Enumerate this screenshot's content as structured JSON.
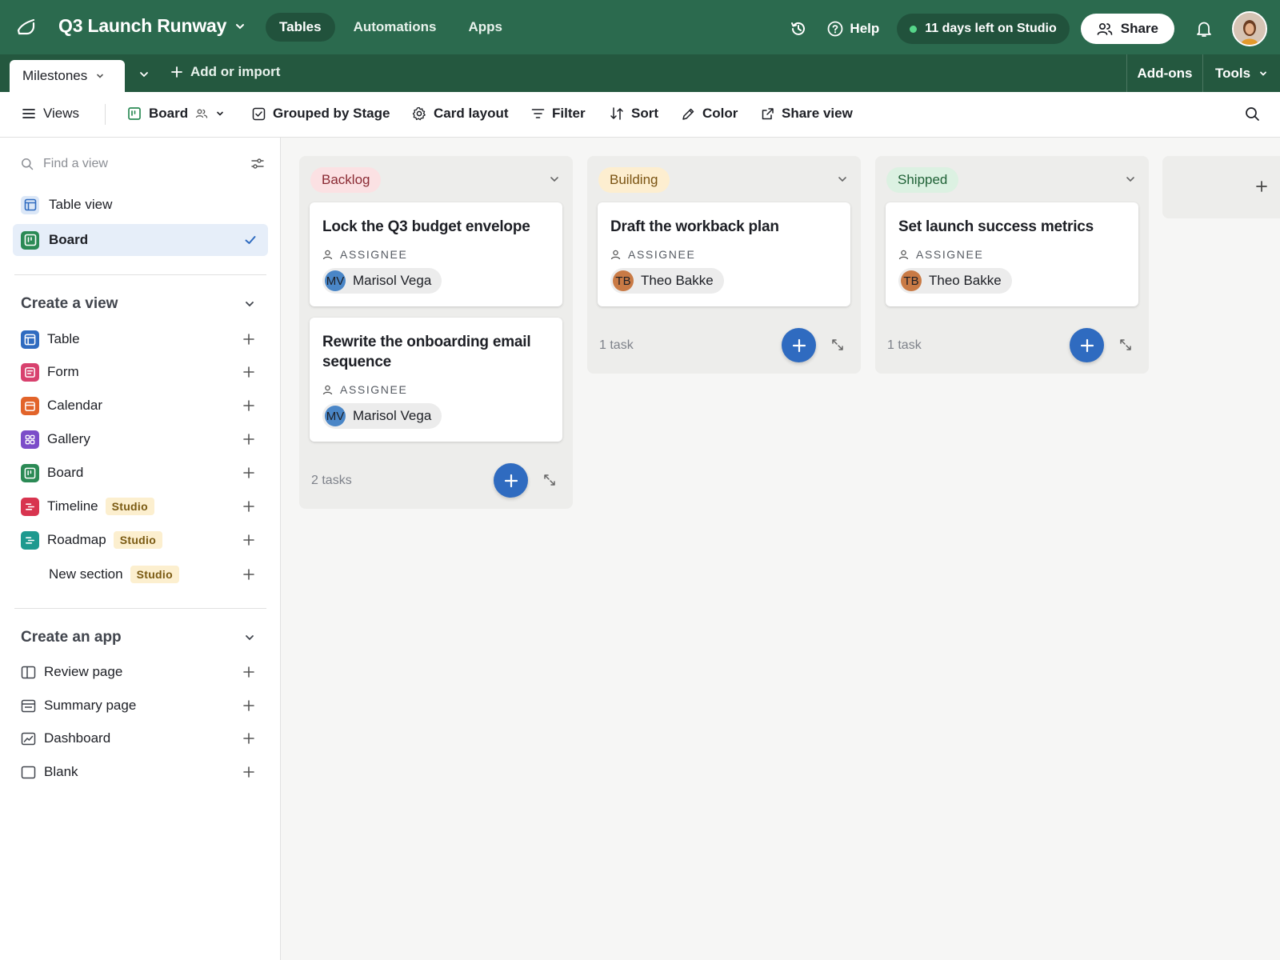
{
  "header": {
    "base_title": "Q3 Launch Runway",
    "nav": [
      "Tables",
      "Automations",
      "Apps"
    ],
    "active_nav": "Tables",
    "help": "Help",
    "trial": "11 days left on Studio",
    "share": "Share",
    "icons": [
      "base-logo-icon",
      "history-icon",
      "help-icon",
      "share-people-icon",
      "bell-icon",
      "user-avatar"
    ]
  },
  "tablebar": {
    "active_table": "Milestones",
    "add_or_import": "Add or import",
    "addons": "Add-ons",
    "tools": "Tools"
  },
  "viewbar": {
    "views": "Views",
    "view_name": "Board",
    "grouped": "Grouped by Stage",
    "card_layout": "Card layout",
    "filter": "Filter",
    "sort": "Sort",
    "color": "Color",
    "share_view": "Share view"
  },
  "sidebar": {
    "find_placeholder": "Find a view",
    "views": [
      {
        "label": "Table view",
        "selected": false
      },
      {
        "label": "Board",
        "selected": true
      }
    ],
    "create_view_title": "Create a view",
    "create_view_items": [
      {
        "label": "Table",
        "badge": ""
      },
      {
        "label": "Form",
        "badge": ""
      },
      {
        "label": "Calendar",
        "badge": ""
      },
      {
        "label": "Gallery",
        "badge": ""
      },
      {
        "label": "Board",
        "badge": ""
      },
      {
        "label": "Timeline",
        "badge": "Studio"
      },
      {
        "label": "Roadmap",
        "badge": "Studio"
      },
      {
        "label": "New section",
        "badge": "Studio"
      }
    ],
    "create_app_title": "Create an app",
    "create_app_items": [
      "Review page",
      "Summary page",
      "Dashboard",
      "Blank"
    ]
  },
  "board": {
    "field_label": "ASSIGNEE",
    "stacks": [
      {
        "stage": "Backlog",
        "pill_bg": "#fbe1e3",
        "pill_fg": "#8a2a33",
        "count": "2 tasks",
        "cards": [
          {
            "title": "Lock the Q3 budget envelope",
            "assignee": "Marisol Vega",
            "initials": "MV",
            "avatar_color": "#4a86c7"
          },
          {
            "title": "Rewrite the onboarding email sequence",
            "assignee": "Marisol Vega",
            "initials": "MV",
            "avatar_color": "#4a86c7"
          }
        ]
      },
      {
        "stage": "Building",
        "pill_bg": "#fdeed0",
        "pill_fg": "#7a5312",
        "count": "1 task",
        "cards": [
          {
            "title": "Draft the workback plan",
            "assignee": "Theo Bakke",
            "initials": "TB",
            "avatar_color": "#c97a45"
          }
        ]
      },
      {
        "stage": "Shipped",
        "pill_bg": "#dcf1e2",
        "pill_fg": "#1f6136",
        "count": "1 task",
        "cards": [
          {
            "title": "Set launch success metrics",
            "assignee": "Theo Bakke",
            "initials": "TB",
            "avatar_color": "#c97a45"
          }
        ]
      }
    ]
  },
  "colors": {
    "header_bg": "#2b6a4e",
    "tablebar_bg": "#24583f",
    "accent_blue": "#2f6bc0",
    "selected_view_bg": "#e6eef9"
  }
}
